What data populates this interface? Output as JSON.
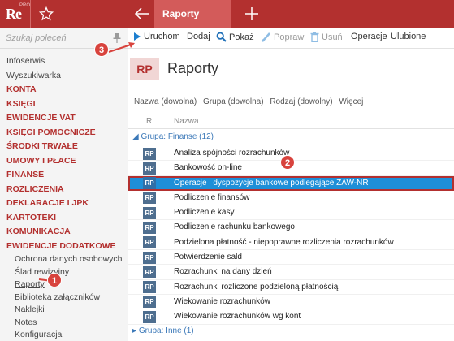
{
  "app": {
    "logo_text": "Re",
    "logo_sup": "PRO"
  },
  "tabs": [
    {
      "label": "Raporty"
    }
  ],
  "sidebar": {
    "search_placeholder": "Szukaj poleceń",
    "items": [
      {
        "label": "Infoserwis",
        "type": "plain"
      },
      {
        "label": "Wyszukiwarka",
        "type": "plain"
      },
      {
        "label": "KONTA",
        "type": "cat"
      },
      {
        "label": "KSIĘGI",
        "type": "cat"
      },
      {
        "label": "EWIDENCJE VAT",
        "type": "cat"
      },
      {
        "label": "KSIĘGI POMOCNICZE",
        "type": "cat"
      },
      {
        "label": "ŚRODKI TRWAŁE",
        "type": "cat"
      },
      {
        "label": "UMOWY I PŁACE",
        "type": "cat"
      },
      {
        "label": "FINANSE",
        "type": "cat"
      },
      {
        "label": "ROZLICZENIA",
        "type": "cat"
      },
      {
        "label": "DEKLARACJE I JPK",
        "type": "cat"
      },
      {
        "label": "KARTOTEKI",
        "type": "cat"
      },
      {
        "label": "KOMUNIKACJA",
        "type": "cat"
      },
      {
        "label": "EWIDENCJE DODATKOWE",
        "type": "cat"
      }
    ],
    "subitems": [
      {
        "label": "Ochrona danych osobowych"
      },
      {
        "label": "Ślad rewizyjny"
      },
      {
        "label": "Raporty",
        "selected": true
      },
      {
        "label": "Biblioteka załączników"
      },
      {
        "label": "Naklejki"
      },
      {
        "label": "Notes"
      },
      {
        "label": "Konfiguracja"
      }
    ]
  },
  "toolbar": {
    "run": "Uruchom",
    "add": "Dodaj",
    "show": "Pokaż",
    "edit": "Popraw",
    "delete": "Usuń",
    "operations": "Operacje",
    "favorites": "Ulubione"
  },
  "header": {
    "badge": "RP",
    "title": "Raporty"
  },
  "filters": [
    "Nazwa (dowolna)",
    "Grupa (dowolna)",
    "Rodzaj (dowolny)",
    "Więcej"
  ],
  "table": {
    "col_r": "R",
    "col_name": "Nazwa",
    "group1": "Grupa: Finanse (12)",
    "group2": "Grupa: Inne (1)",
    "icon_text": "RP",
    "rows": [
      {
        "name": "Analiza spójności rozrachunków"
      },
      {
        "name": "Bankowość on-line"
      },
      {
        "name": "Operacje i dyspozycje bankowe podlegające ZAW-NR",
        "selected": true
      },
      {
        "name": "Podliczenie finansów"
      },
      {
        "name": "Podliczenie kasy"
      },
      {
        "name": "Podliczenie rachunku bankowego"
      },
      {
        "name": "Podzielona płatność - niepoprawne rozliczenia rozrachunków"
      },
      {
        "name": "Potwierdzenie sald"
      },
      {
        "name": "Rozrachunki na dany dzień"
      },
      {
        "name": "Rozrachunki rozliczone podzieloną płatnością"
      },
      {
        "name": "Wiekowanie rozrachunków"
      },
      {
        "name": "Wiekowanie rozrachunków wg kont"
      }
    ]
  },
  "callouts": {
    "c1": "1",
    "c2": "2",
    "c3": "3"
  },
  "colors": {
    "brand": "#b3302f",
    "selection": "#1e8fd8",
    "group": "#3b78b8",
    "callout": "#d8433d"
  }
}
